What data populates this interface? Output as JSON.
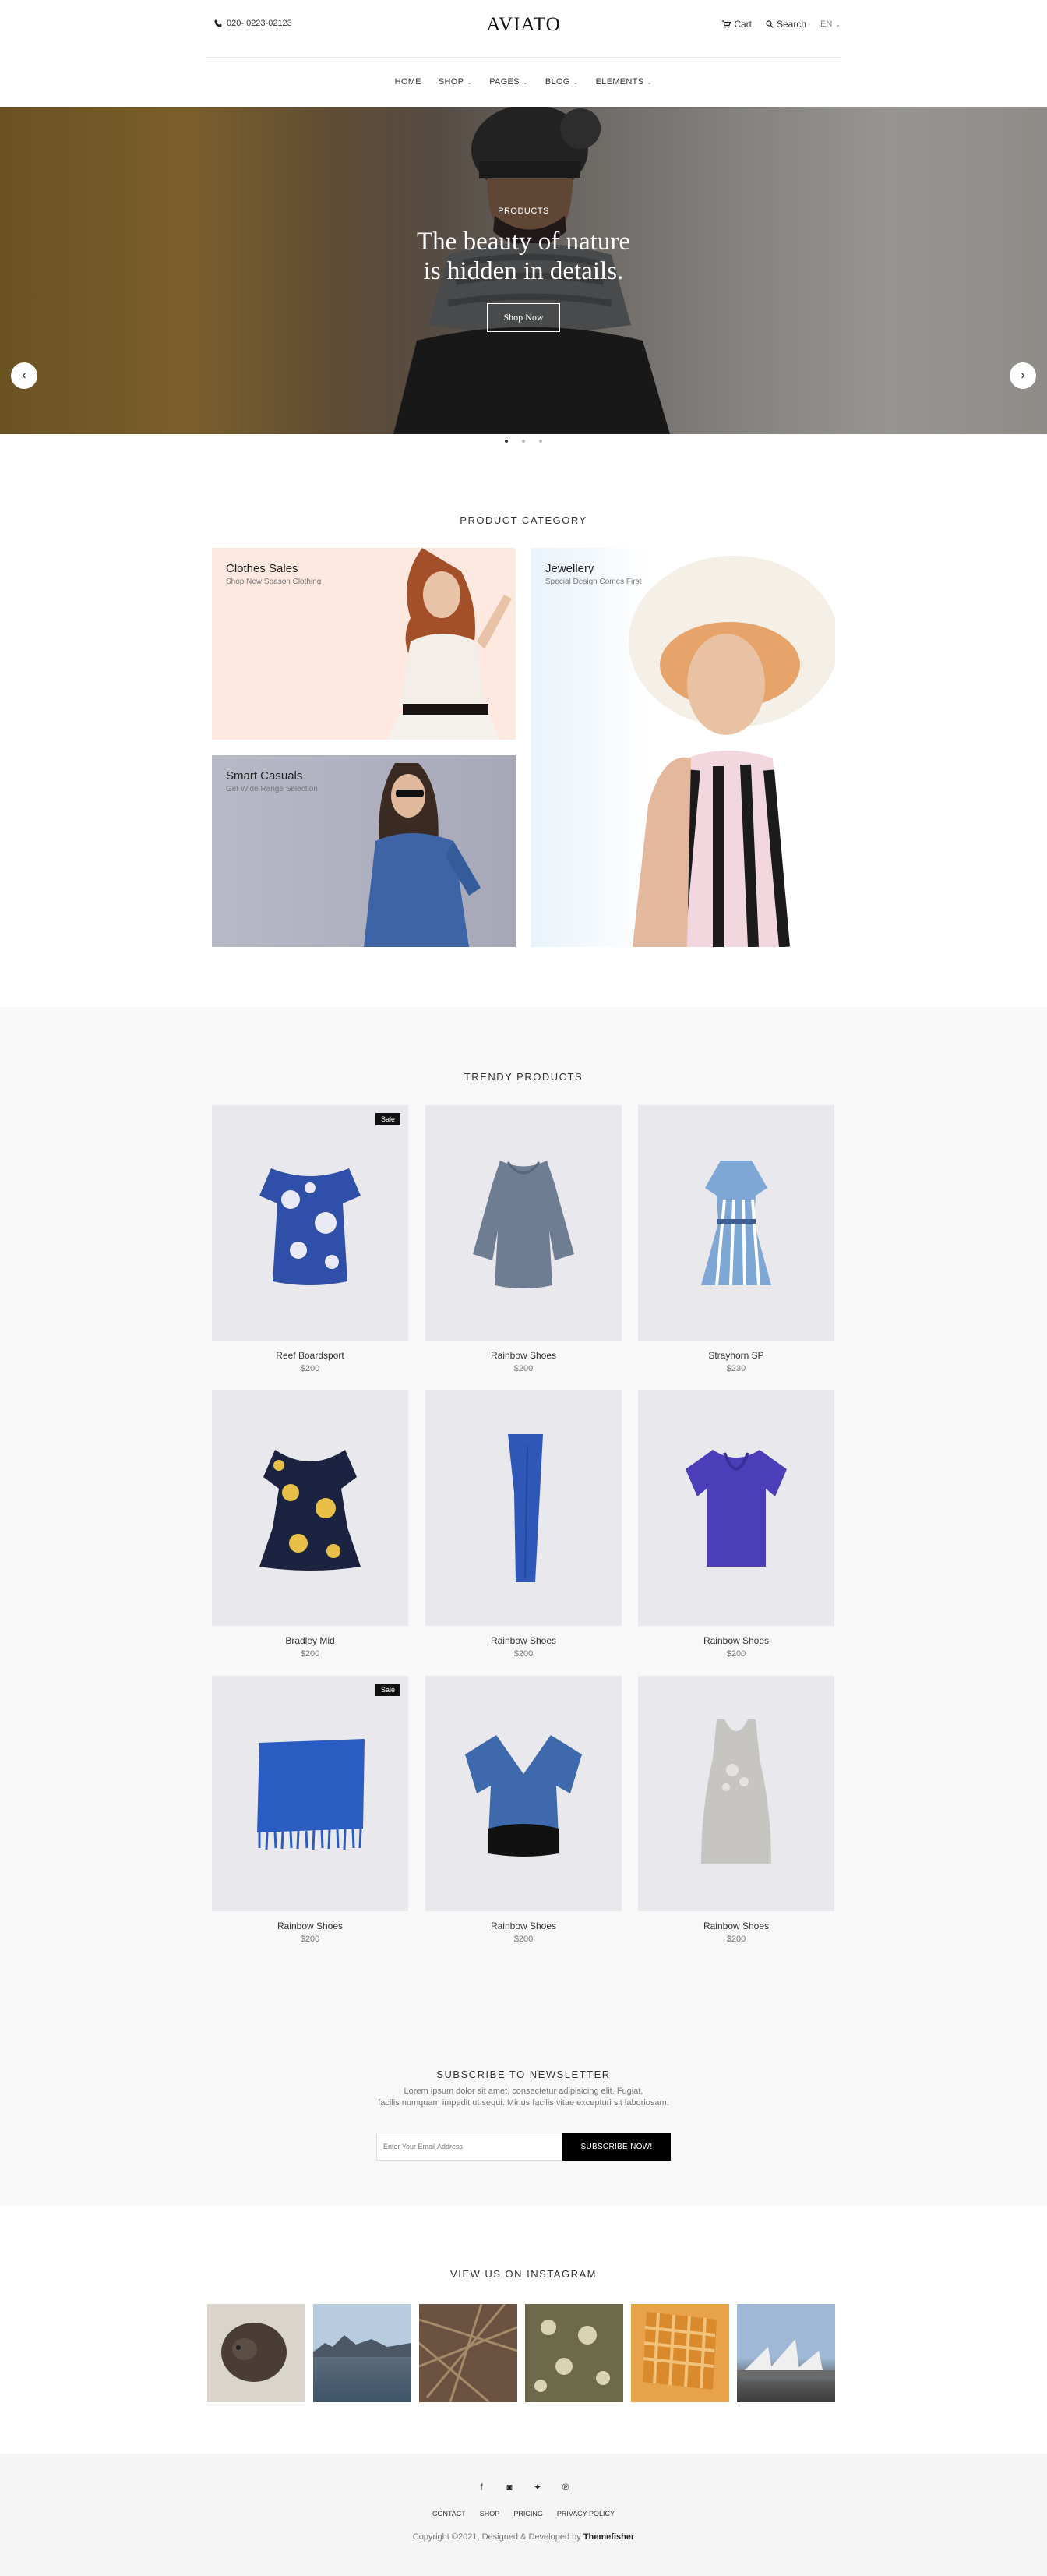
{
  "header": {
    "phone": "020- 0223-02123",
    "logo": "AVIATO",
    "cart": "Cart",
    "search": "Search",
    "language": "EN"
  },
  "nav": {
    "items": [
      {
        "label": "HOME",
        "dropdown": false
      },
      {
        "label": "SHOP",
        "dropdown": true
      },
      {
        "label": "PAGES",
        "dropdown": true
      },
      {
        "label": "BLOG",
        "dropdown": true
      },
      {
        "label": "ELEMENTS",
        "dropdown": true
      }
    ]
  },
  "hero": {
    "subtitle": "PRODUCTS",
    "title_line1": "The beauty of nature",
    "title_line2": "is hidden in details.",
    "button": "Shop Now",
    "slides": 3,
    "active_slide": 1
  },
  "categories": {
    "title": "PRODUCT CATEGORY",
    "items": [
      {
        "title": "Clothes Sales",
        "subtitle": "Shop New Season Clothing"
      },
      {
        "title": "Smart Casuals",
        "subtitle": "Get Wide Range Selection"
      },
      {
        "title": "Jewellery",
        "subtitle": "Special Design Comes First"
      }
    ]
  },
  "trendy": {
    "title": "TRENDY PRODUCTS",
    "products": [
      {
        "name": "Reef Boardsport",
        "price": "$200",
        "sale": "Sale"
      },
      {
        "name": "Rainbow Shoes",
        "price": "$200",
        "sale": ""
      },
      {
        "name": "Strayhorn SP",
        "price": "$230",
        "sale": ""
      },
      {
        "name": "Bradley Mid",
        "price": "$200",
        "sale": ""
      },
      {
        "name": "Rainbow Shoes",
        "price": "$200",
        "sale": ""
      },
      {
        "name": "Rainbow Shoes",
        "price": "$200",
        "sale": ""
      },
      {
        "name": "Rainbow Shoes",
        "price": "$200",
        "sale": "Sale"
      },
      {
        "name": "Rainbow Shoes",
        "price": "$200",
        "sale": ""
      },
      {
        "name": "Rainbow Shoes",
        "price": "$200",
        "sale": ""
      }
    ]
  },
  "newsletter": {
    "title": "SUBSCRIBE TO NEWSLETTER",
    "text_line1": "Lorem ipsum dolor sit amet, consectetur adipisicing elit. Fugiat,",
    "text_line2": "facilis numquam impedit ut sequi. Minus facilis vitae excepturi sit laboriosam.",
    "placeholder": "Enter Your Email Address",
    "button": "SUBSCRIBE NOW!"
  },
  "instagram": {
    "title": "VIEW US ON INSTAGRAM"
  },
  "footer": {
    "social": [
      "f",
      "ig",
      "tw",
      "p"
    ],
    "links": [
      "CONTACT",
      "SHOP",
      "PRICING",
      "PRIVACY POLICY"
    ],
    "copyright": "Copyright ©2021, Designed & Developed by",
    "brand": "Themefisher"
  }
}
